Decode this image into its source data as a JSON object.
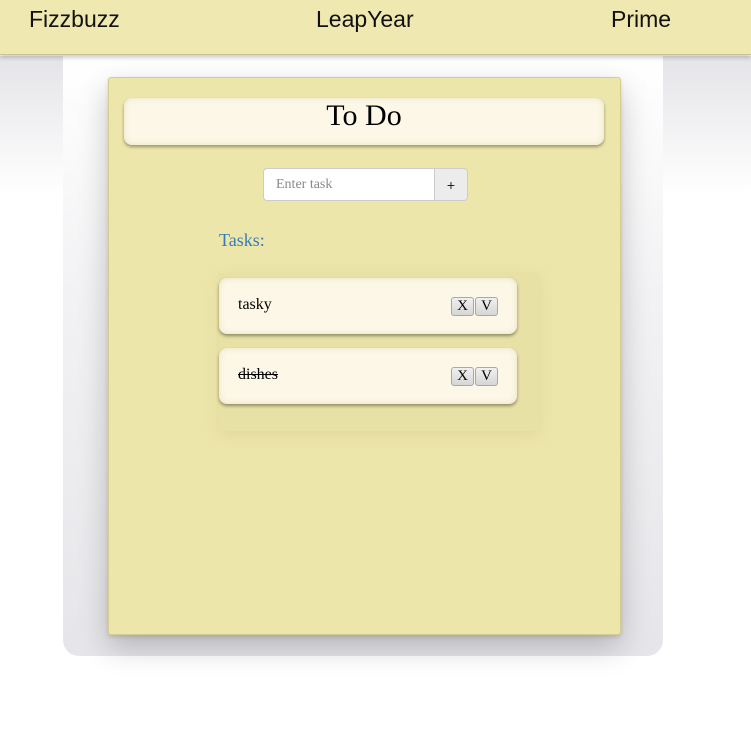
{
  "nav": {
    "items": [
      {
        "label": "Fizzbuzz"
      },
      {
        "label": "LeapYear"
      },
      {
        "label": "Prime"
      }
    ]
  },
  "todo": {
    "title": "To Do",
    "input": {
      "placeholder": "Enter task",
      "value": ""
    },
    "add_label": "+",
    "tasks_label": "Tasks:",
    "tasks": [
      {
        "text": "tasky",
        "done": false,
        "delete_label": "X",
        "check_label": "V"
      },
      {
        "text": "dishes",
        "done": true,
        "delete_label": "X",
        "check_label": "V"
      }
    ]
  }
}
